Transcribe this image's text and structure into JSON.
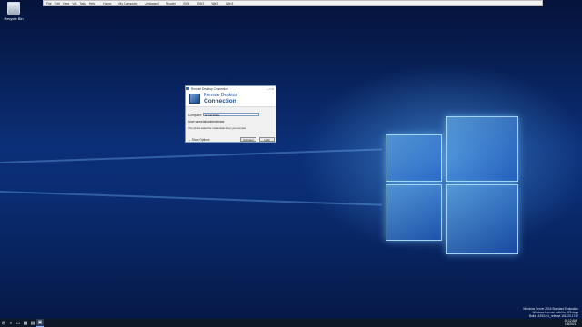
{
  "desktop": {
    "icon_label": "Recycle Bin"
  },
  "vm_toolbar": {
    "menus": [
      "File",
      "Edit",
      "View",
      "VM",
      "Tabs",
      "Help"
    ],
    "buttons": [
      "Home",
      "My Computer",
      "Untagged",
      "Router",
      "SW1",
      "SW2",
      "Win2",
      "Win3"
    ]
  },
  "dialog": {
    "title": "Remote Desktop Connection",
    "controls": "–  □  ×",
    "banner_line1": "Remote Desktop",
    "banner_line2": "Connection",
    "computer_label": "Computer:",
    "computer_value": "10.10.10.10",
    "username_label": "User name:",
    "username_value": "lab\\administrator",
    "note": "You will be asked for credentials when you connect.",
    "show_options": "Show Options",
    "connect": "Connect",
    "help": "Help"
  },
  "watermark": {
    "line1": "Windows Server 2016 Standard Evaluation",
    "line2": "Windows License valid for 178 days",
    "line3": "Build 14393.rs1_release.161220-1747"
  },
  "taskbar": {
    "start_icon": "windows-logo-icon",
    "time": "10:12 AM",
    "date": "1/5/2021"
  }
}
